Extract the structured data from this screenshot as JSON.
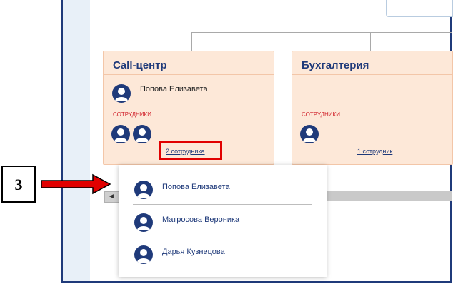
{
  "step_number": "3",
  "departments": [
    {
      "title": "Call-центр",
      "head_name": "Попова Елизавета",
      "staff_label": "СОТРУДНИКИ",
      "staff_count_link": "2 сотрудника"
    },
    {
      "title": "Бухгалтерия",
      "staff_label": "СОТРУДНИКИ",
      "staff_count_link": "1 сотрудник"
    }
  ],
  "popup": {
    "employees": [
      {
        "name": "Попова Елизавета"
      },
      {
        "name": "Матросова Вероника"
      },
      {
        "name": "Дарья Кузнецова"
      }
    ]
  },
  "scroll": {
    "left_arrow": "◄"
  },
  "colors": {
    "accent": "#1f3a7a",
    "card_bg": "#fde8d8",
    "highlight": "#e10000",
    "staff_label": "#d0202a"
  },
  "icons": {
    "avatar": "user-avatar-icon",
    "arrow": "red-arrow-icon"
  }
}
